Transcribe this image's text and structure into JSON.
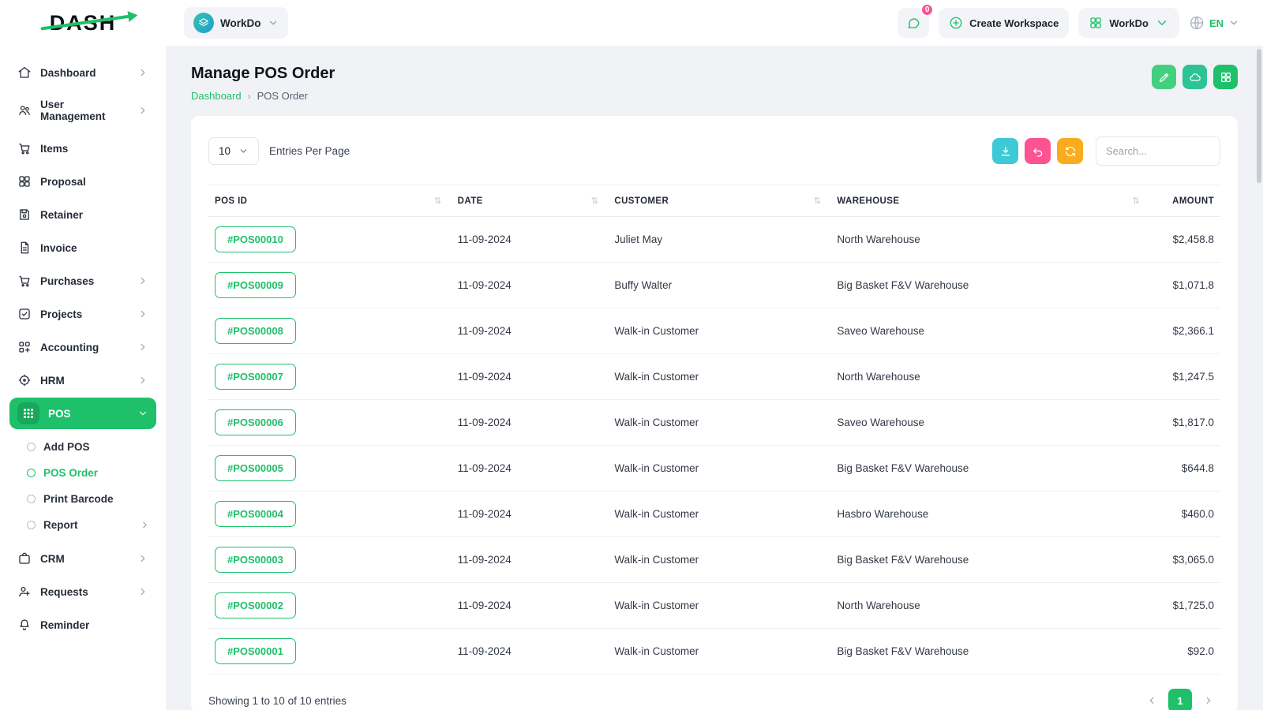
{
  "brand": {
    "logo_text": "DASH"
  },
  "topbar": {
    "workspace_pill_label": "WorkDo",
    "messages_badge": "0",
    "create_workspace_label": "Create Workspace",
    "app_dropdown_label": "WorkDo",
    "language_code": "EN"
  },
  "sidebar": {
    "items": [
      {
        "label": "Dashboard"
      },
      {
        "label": "User Management"
      },
      {
        "label": "Items"
      },
      {
        "label": "Proposal"
      },
      {
        "label": "Retainer"
      },
      {
        "label": "Invoice"
      },
      {
        "label": "Purchases"
      },
      {
        "label": "Projects"
      },
      {
        "label": "Accounting"
      },
      {
        "label": "HRM"
      },
      {
        "label": "POS"
      },
      {
        "label": "CRM"
      },
      {
        "label": "Requests"
      },
      {
        "label": "Reminder"
      }
    ],
    "pos_children": [
      {
        "label": "Add POS"
      },
      {
        "label": "POS Order"
      },
      {
        "label": "Print Barcode"
      },
      {
        "label": "Report"
      }
    ]
  },
  "page": {
    "title": "Manage POS Order",
    "breadcrumb_home": "Dashboard",
    "breadcrumb_current": "POS Order"
  },
  "toolbar": {
    "entries_per_page_value": "10",
    "entries_per_page_label": "Entries Per Page",
    "search_placeholder": "Search..."
  },
  "table": {
    "headers": [
      "POS ID",
      "DATE",
      "CUSTOMER",
      "WAREHOUSE",
      "AMOUNT"
    ],
    "rows": [
      {
        "pos_id": "#POS00010",
        "date": "11-09-2024",
        "customer": "Juliet May",
        "warehouse": "North Warehouse",
        "amount": "$2,458.8"
      },
      {
        "pos_id": "#POS00009",
        "date": "11-09-2024",
        "customer": "Buffy Walter",
        "warehouse": "Big Basket F&V Warehouse",
        "amount": "$1,071.8"
      },
      {
        "pos_id": "#POS00008",
        "date": "11-09-2024",
        "customer": "Walk-in Customer",
        "warehouse": "Saveo Warehouse",
        "amount": "$2,366.1"
      },
      {
        "pos_id": "#POS00007",
        "date": "11-09-2024",
        "customer": "Walk-in Customer",
        "warehouse": "North Warehouse",
        "amount": "$1,247.5"
      },
      {
        "pos_id": "#POS00006",
        "date": "11-09-2024",
        "customer": "Walk-in Customer",
        "warehouse": "Saveo Warehouse",
        "amount": "$1,817.0"
      },
      {
        "pos_id": "#POS00005",
        "date": "11-09-2024",
        "customer": "Walk-in Customer",
        "warehouse": "Big Basket F&V Warehouse",
        "amount": "$644.8"
      },
      {
        "pos_id": "#POS00004",
        "date": "11-09-2024",
        "customer": "Walk-in Customer",
        "warehouse": "Hasbro Warehouse",
        "amount": "$460.0"
      },
      {
        "pos_id": "#POS00003",
        "date": "11-09-2024",
        "customer": "Walk-in Customer",
        "warehouse": "Big Basket F&V Warehouse",
        "amount": "$3,065.0"
      },
      {
        "pos_id": "#POS00002",
        "date": "11-09-2024",
        "customer": "Walk-in Customer",
        "warehouse": "North Warehouse",
        "amount": "$1,725.0"
      },
      {
        "pos_id": "#POS00001",
        "date": "11-09-2024",
        "customer": "Walk-in Customer",
        "warehouse": "Big Basket F&V Warehouse",
        "amount": "$92.0"
      }
    ],
    "showing_text": "Showing 1 to 10 of 10 entries",
    "current_page": "1"
  },
  "colors": {
    "accent_green": "#1fc06a",
    "pink": "#fd5393",
    "orange": "#fbab1e",
    "cyan": "#3ec9d6",
    "content_bg": "#f1f2f6"
  }
}
